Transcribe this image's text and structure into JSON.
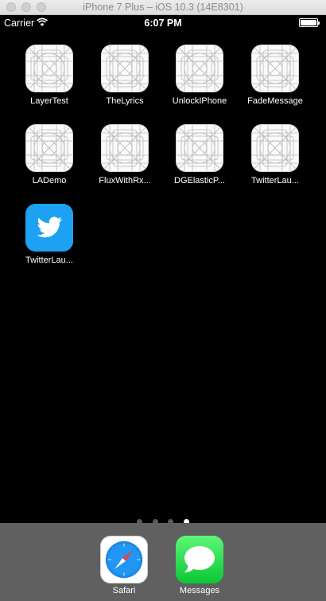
{
  "window": {
    "title": "iPhone 7 Plus – iOS 10.3 (14E8301)"
  },
  "status_bar": {
    "carrier": "Carrier",
    "time": "6:07 PM",
    "battery_level": 1.0
  },
  "home": {
    "rows": [
      [
        {
          "label": "LayerTest",
          "icon": "placeholder-icon"
        },
        {
          "label": "TheLyrics",
          "icon": "placeholder-icon"
        },
        {
          "label": "UnlockIPhone",
          "icon": "placeholder-icon"
        },
        {
          "label": "FadeMessage",
          "icon": "placeholder-icon"
        }
      ],
      [
        {
          "label": "LADemo",
          "icon": "placeholder-icon"
        },
        {
          "label": "FluxWithRx...",
          "icon": "placeholder-icon"
        },
        {
          "label": "DGElasticP...",
          "icon": "placeholder-icon"
        },
        {
          "label": "TwitterLau...",
          "icon": "placeholder-icon"
        }
      ],
      [
        {
          "label": "TwitterLau...",
          "icon": "twitter-bird-icon"
        }
      ]
    ]
  },
  "page_indicator": {
    "count": 4,
    "active_index": 3
  },
  "dock": [
    {
      "label": "Safari",
      "icon": "safari-compass-icon"
    },
    {
      "label": "Messages",
      "icon": "messages-bubble-icon"
    }
  ],
  "colors": {
    "twitter": "#1da1f2",
    "messages_green": "#34c759",
    "safari_blue": "#1e88e5",
    "background": "#000000",
    "dock": "#606060"
  }
}
